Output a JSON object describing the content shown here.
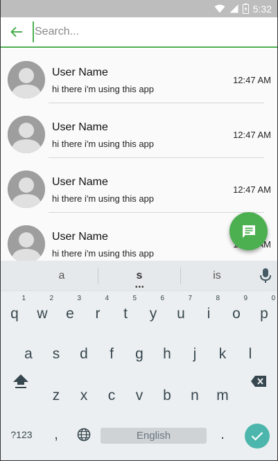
{
  "status_bar": {
    "time": "5:32",
    "icons": [
      "wifi-icon",
      "signal-icon",
      "battery-icon"
    ]
  },
  "search": {
    "placeholder": "Search...",
    "value": ""
  },
  "contacts": [
    {
      "name": "User Name",
      "status": "hi there i'm using this app",
      "time": "12:47 AM"
    },
    {
      "name": "User Name",
      "status": "hi there i'm using this app",
      "time": "12:47 AM"
    },
    {
      "name": "User Name",
      "status": "hi there i'm using this app",
      "time": "12:47 AM"
    },
    {
      "name": "User Name",
      "status": "hi there i'm using this app",
      "time": "12:47 AM"
    }
  ],
  "fab": {
    "icon": "message-icon",
    "color": "#4caf50"
  },
  "keyboard": {
    "suggestions": [
      "a",
      "s",
      "is"
    ],
    "row1": [
      "q",
      "w",
      "e",
      "r",
      "t",
      "y",
      "u",
      "i",
      "o",
      "p"
    ],
    "row1_hints": [
      "1",
      "2",
      "3",
      "4",
      "5",
      "6",
      "7",
      "8",
      "9",
      "0"
    ],
    "row2": [
      "a",
      "s",
      "d",
      "f",
      "g",
      "h",
      "j",
      "k",
      "l"
    ],
    "row3": [
      "z",
      "x",
      "c",
      "v",
      "b",
      "n",
      "m"
    ],
    "symbols_label": "?123",
    "comma_label": ",",
    "period_label": ".",
    "space_label": "English"
  },
  "colors": {
    "accent": "#4caf50",
    "enter": "#4db6ac",
    "status_bar": "#bdbdbd",
    "keyboard_bg": "#eceff1"
  }
}
